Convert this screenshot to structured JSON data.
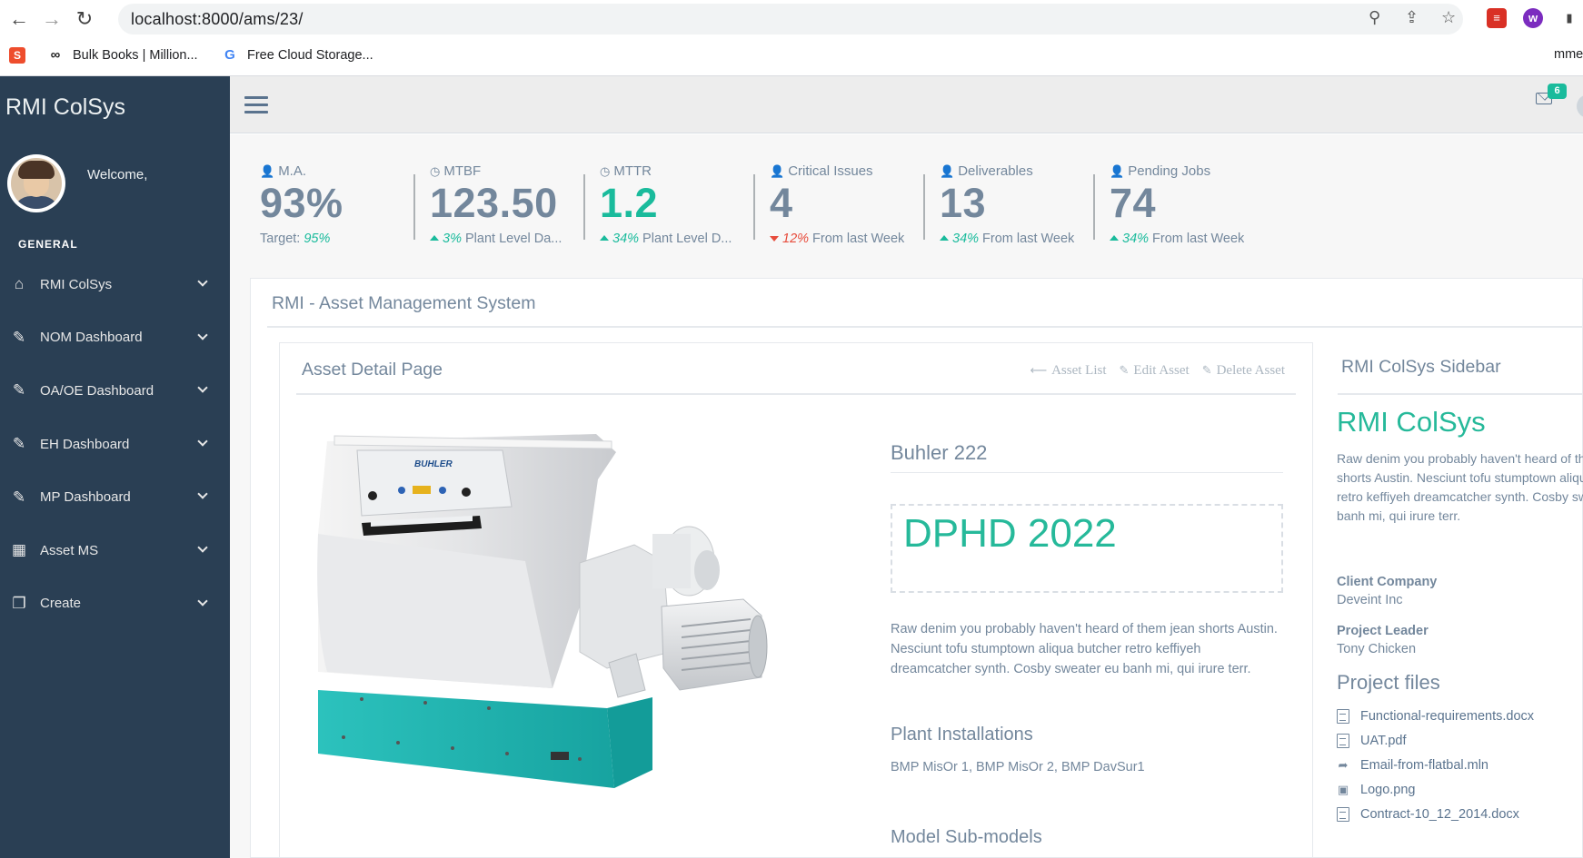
{
  "browser": {
    "url": "localhost:8000/ams/23/",
    "bookmarks": [
      {
        "label": "Bulk Books | Million...",
        "icon": "goodreads-icon"
      },
      {
        "label": "Free Cloud Storage...",
        "icon": "google-icon"
      }
    ],
    "right_cut_text": "mme"
  },
  "sidebar": {
    "brand": "RMI ColSys",
    "welcome": "Welcome,",
    "section": "GENERAL",
    "items": [
      {
        "label": "RMI ColSys",
        "icon": "home-icon"
      },
      {
        "label": "NOM Dashboard",
        "icon": "edit-icon"
      },
      {
        "label": "OA/OE Dashboard",
        "icon": "edit-icon"
      },
      {
        "label": "EH Dashboard",
        "icon": "edit-icon"
      },
      {
        "label": "MP Dashboard",
        "icon": "edit-icon"
      },
      {
        "label": "Asset MS",
        "icon": "table-icon"
      },
      {
        "label": "Create",
        "icon": "clone-icon"
      }
    ]
  },
  "topnav": {
    "mail_count": "6"
  },
  "tiles": [
    {
      "label": "M.A.",
      "value": "93%",
      "foot_prefix": "Target: ",
      "foot_pct": "95%",
      "foot_text": "",
      "trend": "none",
      "value_color": "gray"
    },
    {
      "label": "MTBF",
      "value": "123.50",
      "foot_pct": "3%",
      "foot_text": " Plant Level Da...",
      "trend": "up",
      "value_color": "gray"
    },
    {
      "label": "MTTR",
      "value": "1.2",
      "foot_pct": "34%",
      "foot_text": " Plant Level D...",
      "trend": "up",
      "value_color": "green"
    },
    {
      "label": "Critical Issues",
      "value": "4",
      "foot_pct": "12%",
      "foot_text": " From last Week",
      "trend": "down",
      "value_color": "gray"
    },
    {
      "label": "Deliverables",
      "value": "13",
      "foot_pct": "34%",
      "foot_text": " From last Week",
      "trend": "up",
      "value_color": "gray"
    },
    {
      "label": "Pending Jobs",
      "value": "74",
      "foot_pct": "34%",
      "foot_text": " From last Week",
      "trend": "up",
      "value_color": "gray"
    }
  ],
  "panel": {
    "title": "RMI - Asset Management System"
  },
  "detail": {
    "title": "Asset Detail Page",
    "actions": [
      "Asset List",
      "Edit Asset",
      "Delete Asset"
    ],
    "machine_brand": "BUHLER",
    "asset_name": "Buhler 222",
    "asset_code": "DPHD 2022",
    "description": "Raw denim you probably haven't heard of them jean shorts Austin. Nesciunt tofu stumptown aliqua butcher retro keffiyeh dreamcatcher synth. Cosby sweater eu banh mi, qui irure terr.",
    "plant_installations_title": "Plant Installations",
    "plant_installations": "BMP MisOr 1, BMP MisOr 2, BMP DavSur1",
    "model_submodels_title": "Model Sub-models"
  },
  "right_sidebar": {
    "title": "RMI ColSys Sidebar",
    "brand": "RMI ColSys",
    "text_lines": [
      "Raw denim you probably haven't heard of them jean",
      "shorts Austin. Nesciunt tofu stumptown aliqua butcher",
      "retro keffiyeh dreamcatcher synth. Cosby sweater eu",
      "banh mi, qui irure terr."
    ],
    "client_company_label": "Client Company",
    "client_company": "Deveint Inc",
    "project_leader_label": "Project Leader",
    "project_leader": "Tony Chicken",
    "files_title": "Project files",
    "files": [
      {
        "name": "Functional-requirements.docx",
        "icon": "file-word-icon"
      },
      {
        "name": "UAT.pdf",
        "icon": "file-pdf-icon"
      },
      {
        "name": "Email-from-flatbal.mln",
        "icon": "share-icon"
      },
      {
        "name": "Logo.png",
        "icon": "image-icon"
      },
      {
        "name": "Contract-10_12_2014.docx",
        "icon": "file-word-icon"
      }
    ]
  },
  "colors": {
    "sidebar_bg": "#2A3F54",
    "accent_green": "#1ABB9C",
    "text_gray": "#73879C",
    "down_red": "#E74C3C"
  }
}
